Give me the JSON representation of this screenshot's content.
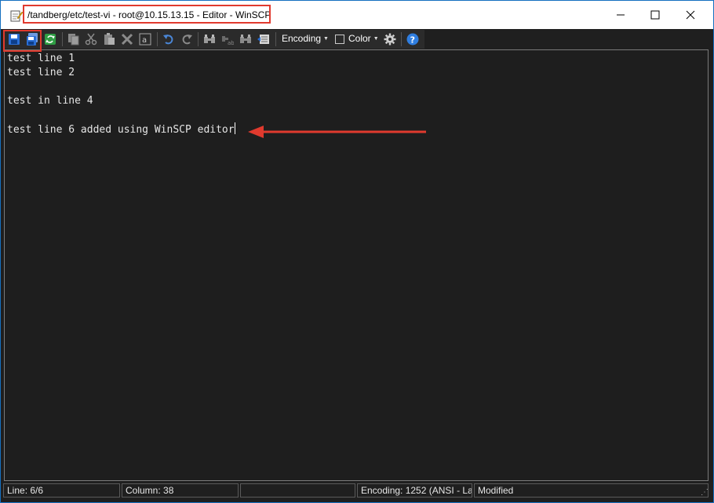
{
  "window": {
    "title": "/tandberg/etc/test-vi - root@10.15.13.15 - Editor - WinSCP",
    "minimize_glyph": "—",
    "maximize_glyph": "☐",
    "close_glyph": "✕"
  },
  "toolbar": {
    "encoding_label": "Encoding",
    "color_label": "Color",
    "help_glyph": "?"
  },
  "editor": {
    "lines": [
      "test line 1",
      "test line 2",
      "",
      "test in line 4",
      "",
      "test line 6 added using WinSCP editor"
    ]
  },
  "status": {
    "line": "Line: 6/6",
    "column": "Column: 38",
    "blank": "",
    "encoding": "Encoding: 1252  (ANSI - La",
    "modified": "Modified"
  },
  "colors": {
    "highlight": "#e03a2e",
    "editor_bg": "#1e1e1e",
    "toolbar_bg": "#1f1f1f",
    "frame": "#0a4a82"
  }
}
